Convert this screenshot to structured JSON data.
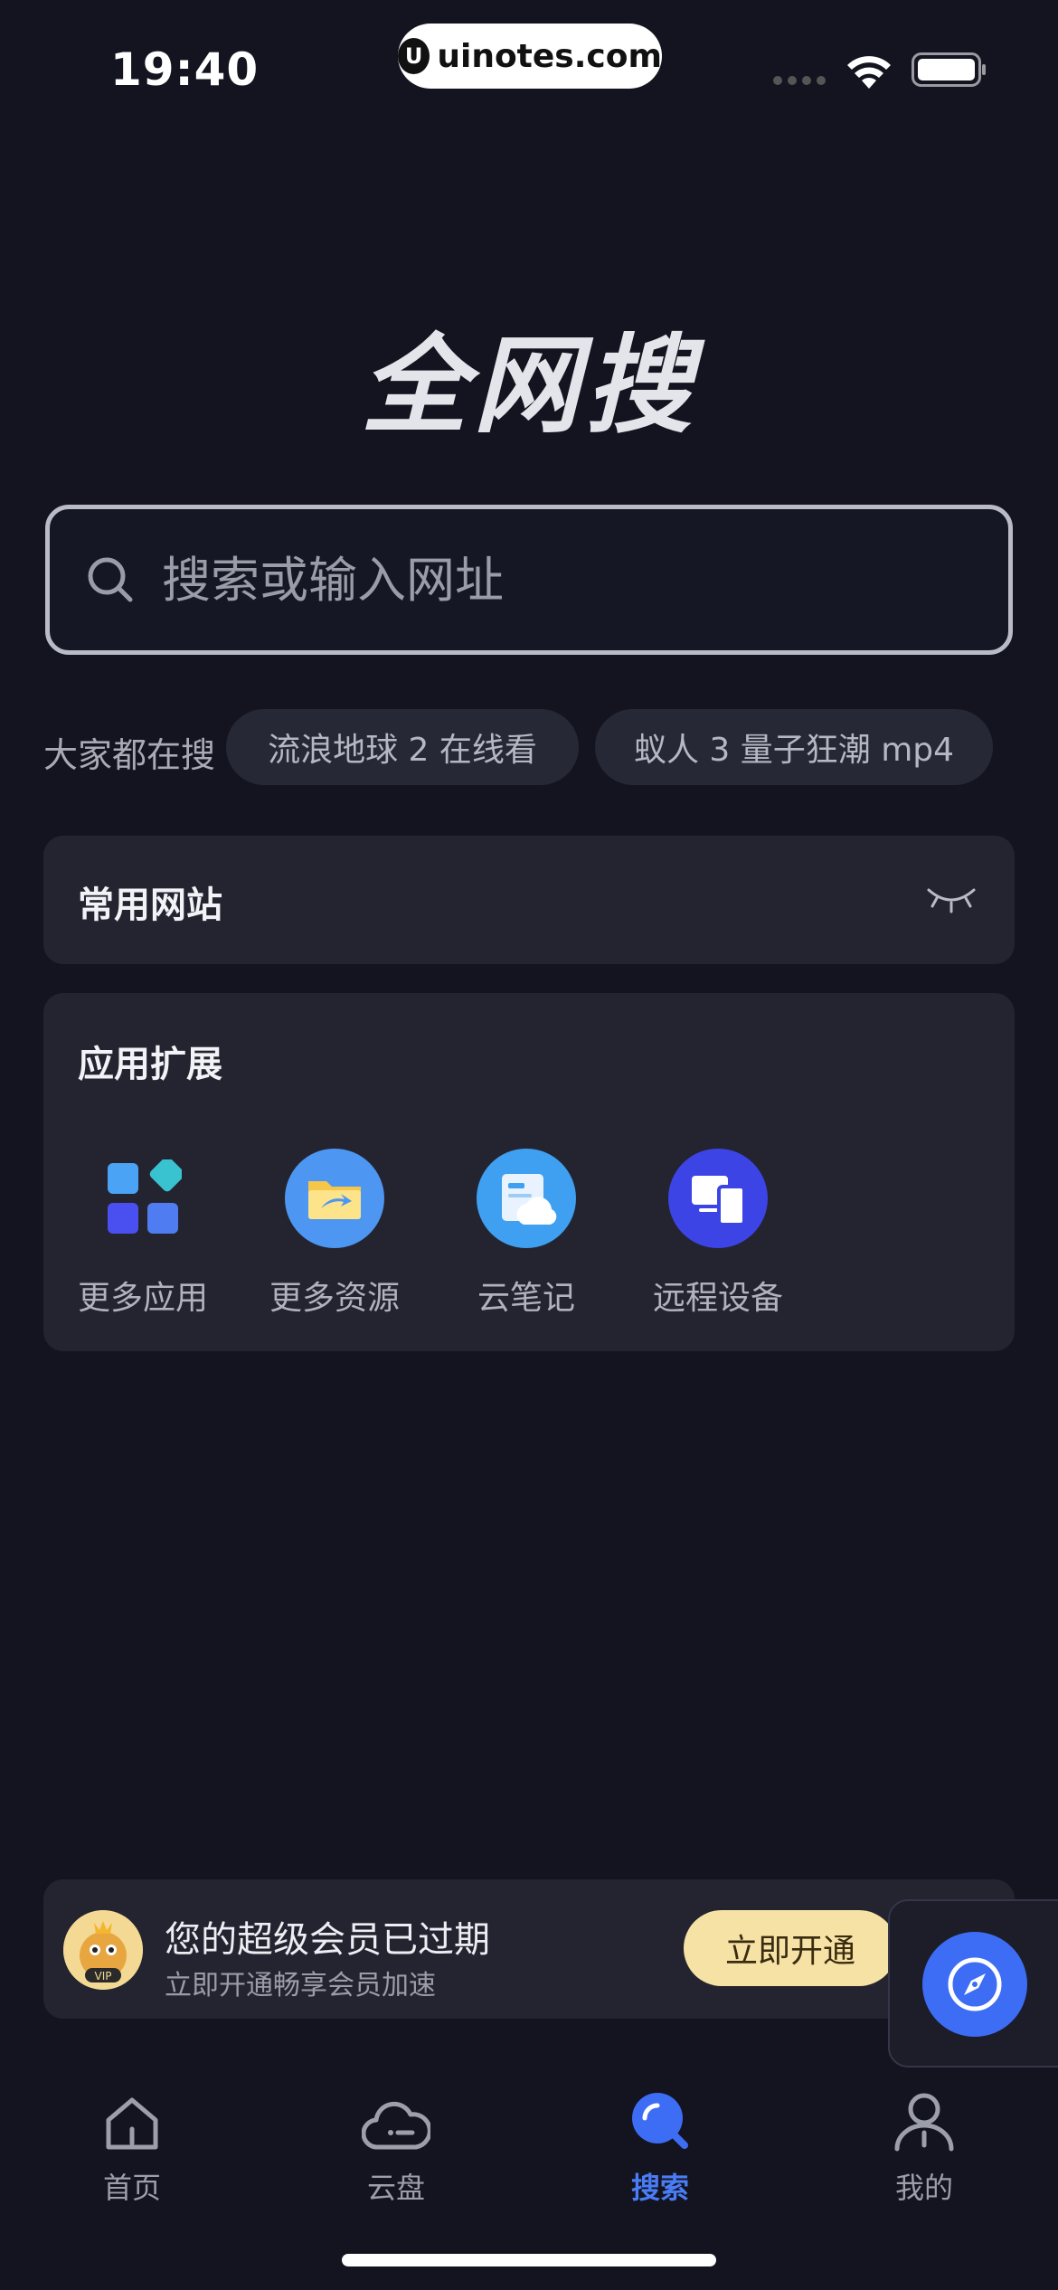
{
  "status_bar": {
    "time": "19:40",
    "watermark": "uinotes.com"
  },
  "page": {
    "title": "全网搜"
  },
  "search": {
    "placeholder": "搜索或输入网址"
  },
  "trending": {
    "label": "大家都在搜",
    "chips": [
      "流浪地球 2 在线看",
      "蚁人 3 量子狂潮 mp4"
    ]
  },
  "common_sites": {
    "title": "常用网站"
  },
  "extensions": {
    "title": "应用扩展",
    "apps": [
      {
        "label": "更多应用",
        "icon": "grid-apps-icon"
      },
      {
        "label": "更多资源",
        "icon": "folder-icon"
      },
      {
        "label": "云笔记",
        "icon": "cloud-note-icon"
      },
      {
        "label": "远程设备",
        "icon": "remote-device-icon"
      }
    ]
  },
  "vip": {
    "title": "您的超级会员已过期",
    "subtitle": "立即开通畅享会员加速",
    "button": "立即开通",
    "badge": "VIP"
  },
  "tabs": [
    {
      "label": "首页",
      "icon": "home-icon"
    },
    {
      "label": "云盘",
      "icon": "cloud-icon"
    },
    {
      "label": "搜索",
      "icon": "search-tab-icon",
      "active": true
    },
    {
      "label": "我的",
      "icon": "user-icon"
    }
  ],
  "colors": {
    "background": "#13141f",
    "panel": "#23242f",
    "accent": "#4a7cf6",
    "vip_button": "#f7e2a6"
  }
}
